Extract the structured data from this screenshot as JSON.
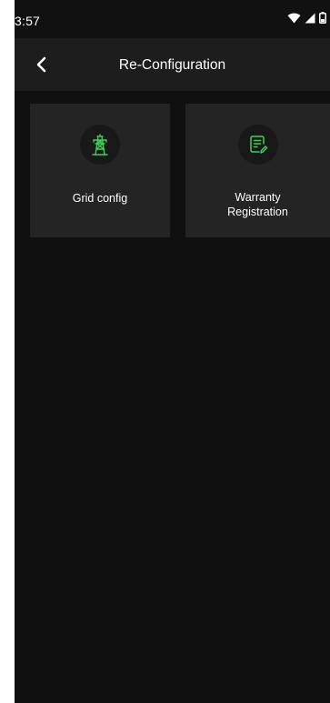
{
  "status_bar": {
    "time": "3:57",
    "icons": [
      "wifi-icon",
      "signal-icon",
      "battery-icon"
    ]
  },
  "app_bar": {
    "title": "Re-Configuration",
    "back_icon": "chevron-left-icon"
  },
  "menu": {
    "items": [
      {
        "label": "Grid config",
        "icon": "transmission-tower-icon"
      },
      {
        "label": "Warranty\nRegistration",
        "icon": "document-edit-icon"
      }
    ]
  },
  "colors": {
    "background": "#101010",
    "app_bar": "#1d1d1d",
    "card": "#242424",
    "accent": "#3ccf5c",
    "text": "#ffffff"
  }
}
